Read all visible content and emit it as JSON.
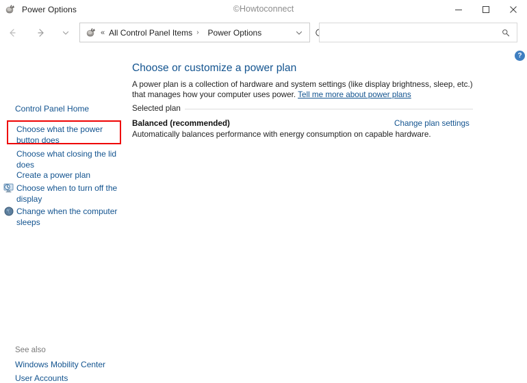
{
  "window": {
    "title": "Power Options",
    "app_icon": "power-options-icon",
    "watermark": "©Howtoconnect",
    "controls": {
      "minimize": "minimize-button",
      "maximize": "maximize-button",
      "close": "close-button"
    }
  },
  "toolbar": {
    "back": "back-arrow-icon",
    "forward": "forward-arrow-icon",
    "recent": "recent-locations-chevron-icon",
    "up": "up-arrow-icon",
    "refresh": "refresh-icon",
    "address": {
      "icon": "power-options-icon",
      "overflow": "«",
      "crumbs": [
        "All Control Panel Items",
        "Power Options"
      ],
      "separator": "›",
      "dropdown": "address-dropdown-chevron-icon"
    },
    "search": {
      "value": "",
      "placeholder": "",
      "icon": "search-icon"
    }
  },
  "help": {
    "label": "?"
  },
  "sidebar": {
    "home_label": "Control Panel Home",
    "items": [
      {
        "label": "Choose what the power button does",
        "icon": null,
        "highlighted": true
      },
      {
        "label": "Choose what closing the lid does",
        "icon": null,
        "highlighted": false
      },
      {
        "label": "Create a power plan",
        "icon": null,
        "highlighted": false
      },
      {
        "label": "Choose when to turn off the display",
        "icon": "display-timeout-icon",
        "highlighted": false
      },
      {
        "label": "Change when the computer sleeps",
        "icon": "sleep-icon",
        "highlighted": false
      }
    ],
    "see_also": {
      "heading": "See also",
      "links": [
        "Windows Mobility Center",
        "User Accounts"
      ]
    }
  },
  "main": {
    "title": "Choose or customize a power plan",
    "description_part1": "A power plan is a collection of hardware and system settings (like display brightness, sleep, etc.) that manages how your computer uses power. ",
    "description_link": "Tell me more about power plans",
    "section_label": "Selected plan",
    "plan_name": "Balanced (recommended)",
    "plan_description": "Automatically balances performance with energy consumption on capable hardware.",
    "change_plan_link": "Change plan settings"
  },
  "colors": {
    "link": "#12538f",
    "highlight": "#ee0000",
    "help_badge": "#3f7fc1",
    "window_bg": "#ffffff"
  }
}
